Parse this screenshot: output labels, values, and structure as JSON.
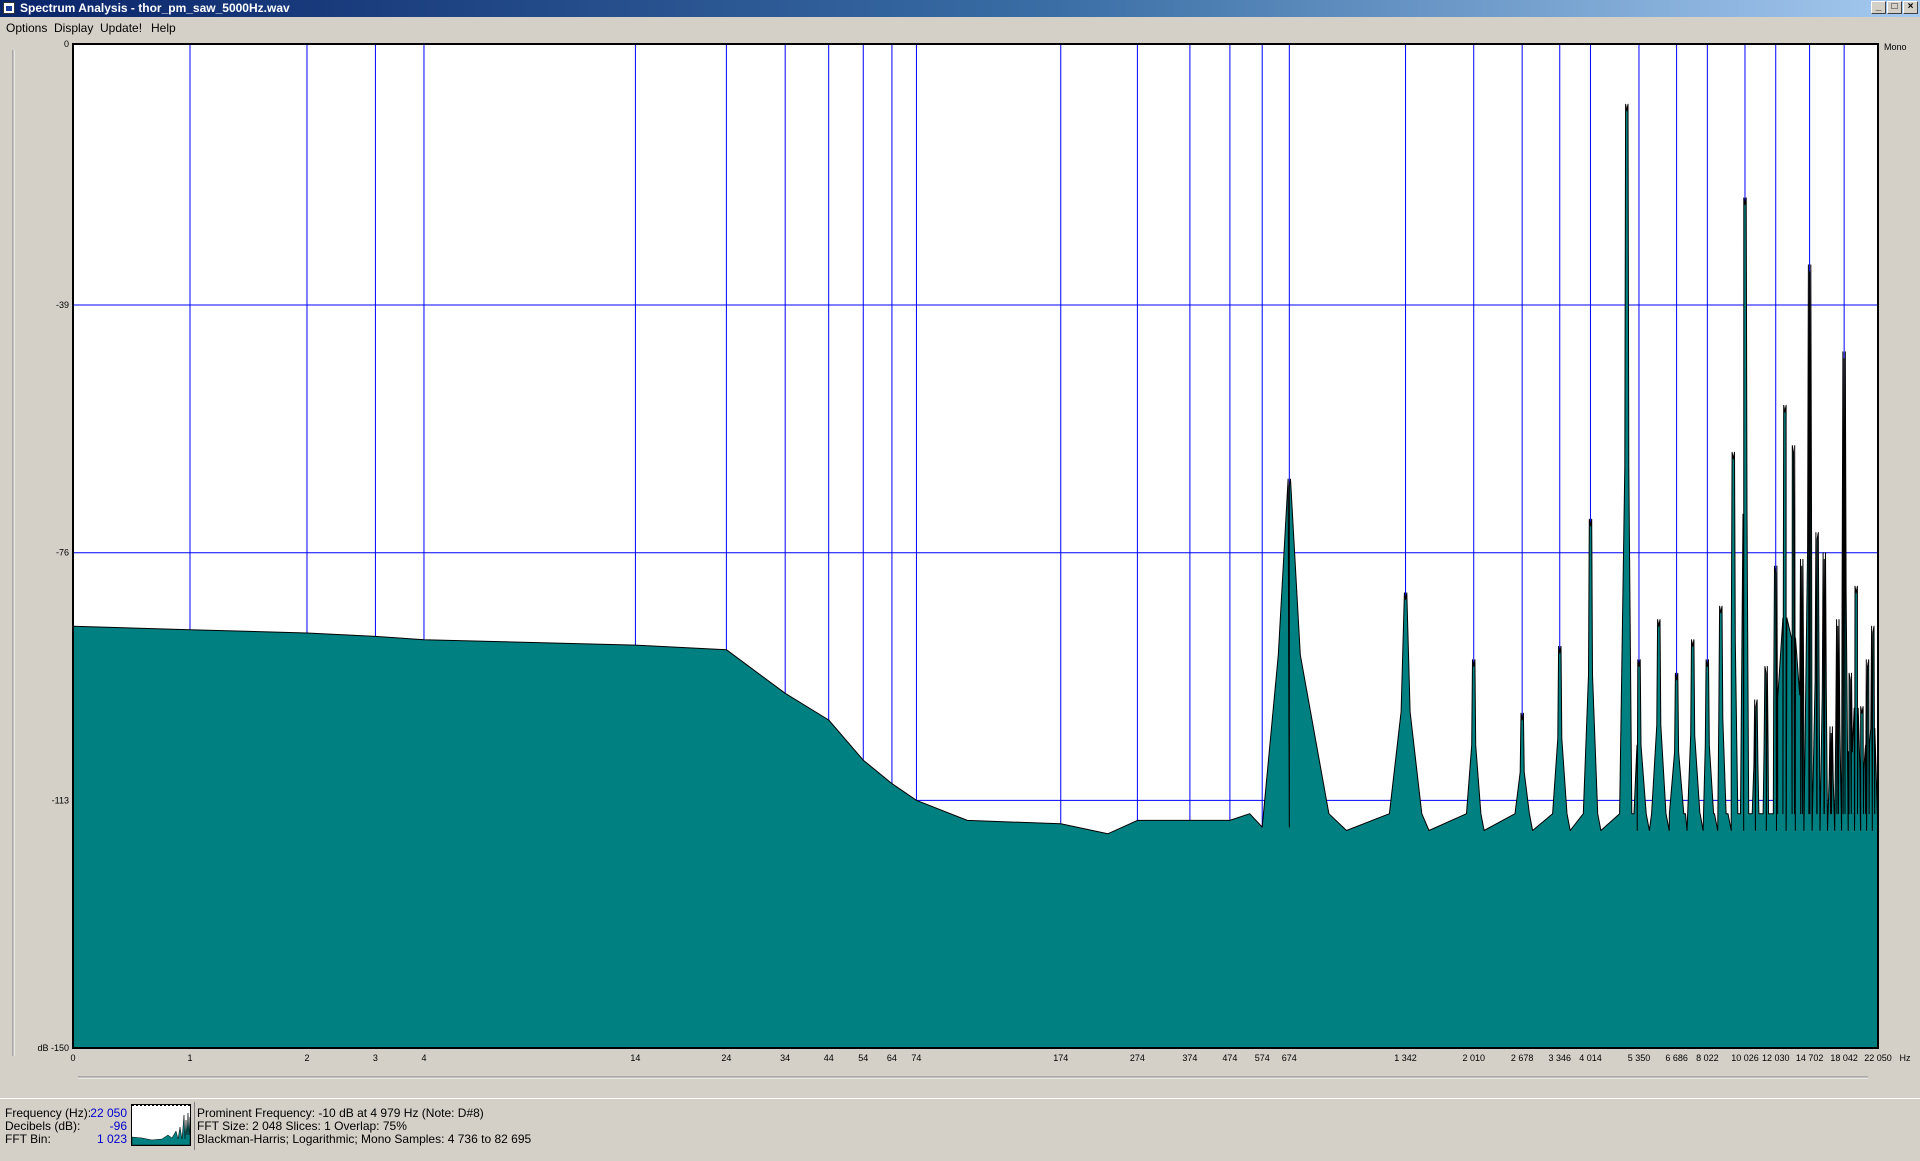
{
  "window": {
    "title": "Spectrum Analysis - thor_pm_saw_5000Hz.wav",
    "buttons": [
      "_",
      "□",
      "×"
    ]
  },
  "menu": {
    "items": [
      "Options",
      "Display",
      "Update!",
      "Help"
    ]
  },
  "chart_data": {
    "type": "area",
    "xscale": "log",
    "x_tick_labels": [
      "0",
      "1",
      "2",
      "3",
      "4",
      "14",
      "24",
      "34",
      "44",
      "54",
      "64",
      "74",
      "174",
      "274",
      "374",
      "474",
      "574",
      "674",
      "1 342",
      "2 010",
      "2 678",
      "3 346",
      "4 014",
      "5 350",
      "6 686",
      "8 022",
      "10 026",
      "12 030",
      "14 702",
      "18 042",
      "22 050"
    ],
    "x_unit": "Hz",
    "y_tick_labels": [
      "0",
      "-39",
      "-76",
      "-113",
      "dB -150"
    ],
    "ylim": [
      -150,
      0
    ],
    "channel_label": "Mono",
    "grid": true,
    "fill_color": "#008080",
    "outline_color": "#000000",
    "grid_color": "#0000ff",
    "series": [
      {
        "x": [
          0.5,
          1,
          2,
          3,
          4,
          14,
          24,
          34,
          44,
          54,
          64,
          74,
          100,
          174,
          230,
          274,
          374,
          474,
          574,
          674
        ],
        "y": [
          -87,
          -87.5,
          -88,
          -88.5,
          -89,
          -89.8,
          -90.5,
          -97,
          -101,
          -107,
          -110.5,
          -113,
          -116,
          -116.5,
          -118,
          -116,
          -116,
          -116,
          -117,
          -117
        ]
      }
    ],
    "peaks": [
      {
        "freq": 674,
        "db": -66
      },
      {
        "freq": 1342,
        "db": -83
      },
      {
        "freq": 2010,
        "db": -93
      },
      {
        "freq": 2678,
        "db": -101
      },
      {
        "freq": 3346,
        "db": -91
      },
      {
        "freq": 4014,
        "db": -72
      },
      {
        "freq": 4979,
        "db": -10
      },
      {
        "freq": 5350,
        "db": -93
      },
      {
        "freq": 6018,
        "db": -87
      },
      {
        "freq": 6686,
        "db": -95
      },
      {
        "freq": 7354,
        "db": -90
      },
      {
        "freq": 8022,
        "db": -93
      },
      {
        "freq": 8690,
        "db": -85
      },
      {
        "freq": 9358,
        "db": -62
      },
      {
        "freq": 10026,
        "db": -24
      },
      {
        "freq": 10694,
        "db": -99
      },
      {
        "freq": 11362,
        "db": -94
      },
      {
        "freq": 12030,
        "db": -79
      },
      {
        "freq": 12698,
        "db": -55
      },
      {
        "freq": 13366,
        "db": -61
      },
      {
        "freq": 14034,
        "db": -78
      },
      {
        "freq": 14702,
        "db": -34
      },
      {
        "freq": 15370,
        "db": -74
      },
      {
        "freq": 16038,
        "db": -77
      },
      {
        "freq": 16706,
        "db": -103
      },
      {
        "freq": 17374,
        "db": -87
      },
      {
        "freq": 18042,
        "db": -47
      },
      {
        "freq": 18710,
        "db": -95
      },
      {
        "freq": 19378,
        "db": -82
      },
      {
        "freq": 20046,
        "db": -100
      },
      {
        "freq": 20714,
        "db": -93
      },
      {
        "freq": 21382,
        "db": -88
      }
    ]
  },
  "status": {
    "labels": [
      "Frequency (Hz):",
      "Decibels (dB):",
      "FFT Bin:"
    ],
    "values": [
      "22 050",
      "-96",
      "1 023"
    ],
    "prominent": "Prominent Frequency: -10 dB at 4 979 Hz (Note: D#8)",
    "fft": "FFT Size: 2 048   Slices: 1   Overlap: 75%",
    "window": "Blackman-Harris; Logarithmic; Mono   Samples: 4 736 to 82 695"
  }
}
